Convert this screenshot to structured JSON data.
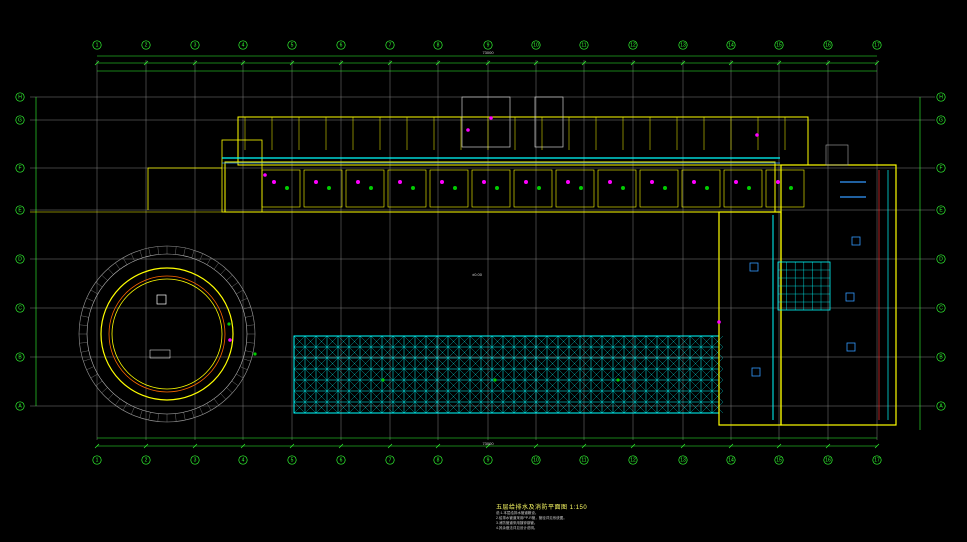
{
  "drawing": {
    "title": "五层给排水及消防平面图",
    "scale": "1:150",
    "notes": [
      "说:1.本层给排水管道敷设。",
      "2.给排水管道采用PP-R管，管径详见系统图。",
      "3.消防管道采用镀锌钢管。",
      "4.其余做法详见设计说明。"
    ]
  },
  "axes": {
    "columns": [
      "1",
      "2",
      "3",
      "4",
      "5",
      "6",
      "7",
      "8",
      "9",
      "10",
      "11",
      "12",
      "13",
      "14",
      "15",
      "16",
      "17"
    ],
    "rows_right": [
      "H",
      "G",
      "F",
      "E",
      "D",
      "C",
      "B",
      "A"
    ],
    "rows_left": [
      "H",
      "G",
      "F",
      "E",
      "D",
      "C",
      "B",
      "A"
    ]
  },
  "dims": {
    "total_top": "73000",
    "total_bottom": "73000",
    "center_label": "±0.00"
  },
  "colors": {
    "background": "#000000",
    "grid": "#808080",
    "axis": "#33ff33",
    "walls": "#ffff00",
    "pipe": "#00ffff",
    "accent": "#ff00ff",
    "dim_text": "#e0e0e0"
  }
}
